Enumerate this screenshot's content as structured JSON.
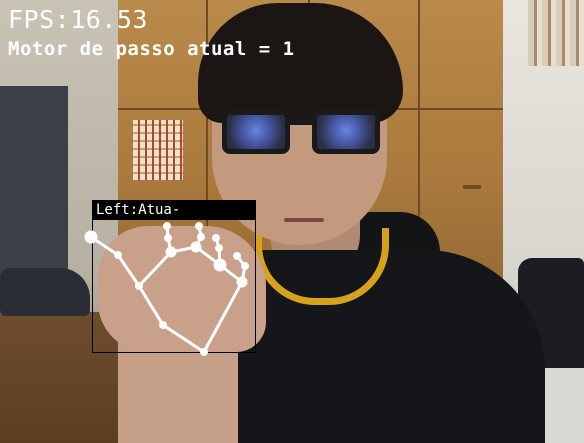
{
  "overlay": {
    "fps_text": "FPS:16.53",
    "motor_text": "Motor de passo atual = 1"
  },
  "hand_detection": {
    "label": "Left:Atua-",
    "box_color": "#000000",
    "label_bg_color": "#000000",
    "label_text_color": "#ffffff",
    "landmark_line_color": "#ffffff",
    "landmark_point_color": "#ffffff"
  },
  "colors": {
    "overlay_text": "#ffffff",
    "shirt_collar": "#d6a21e"
  }
}
